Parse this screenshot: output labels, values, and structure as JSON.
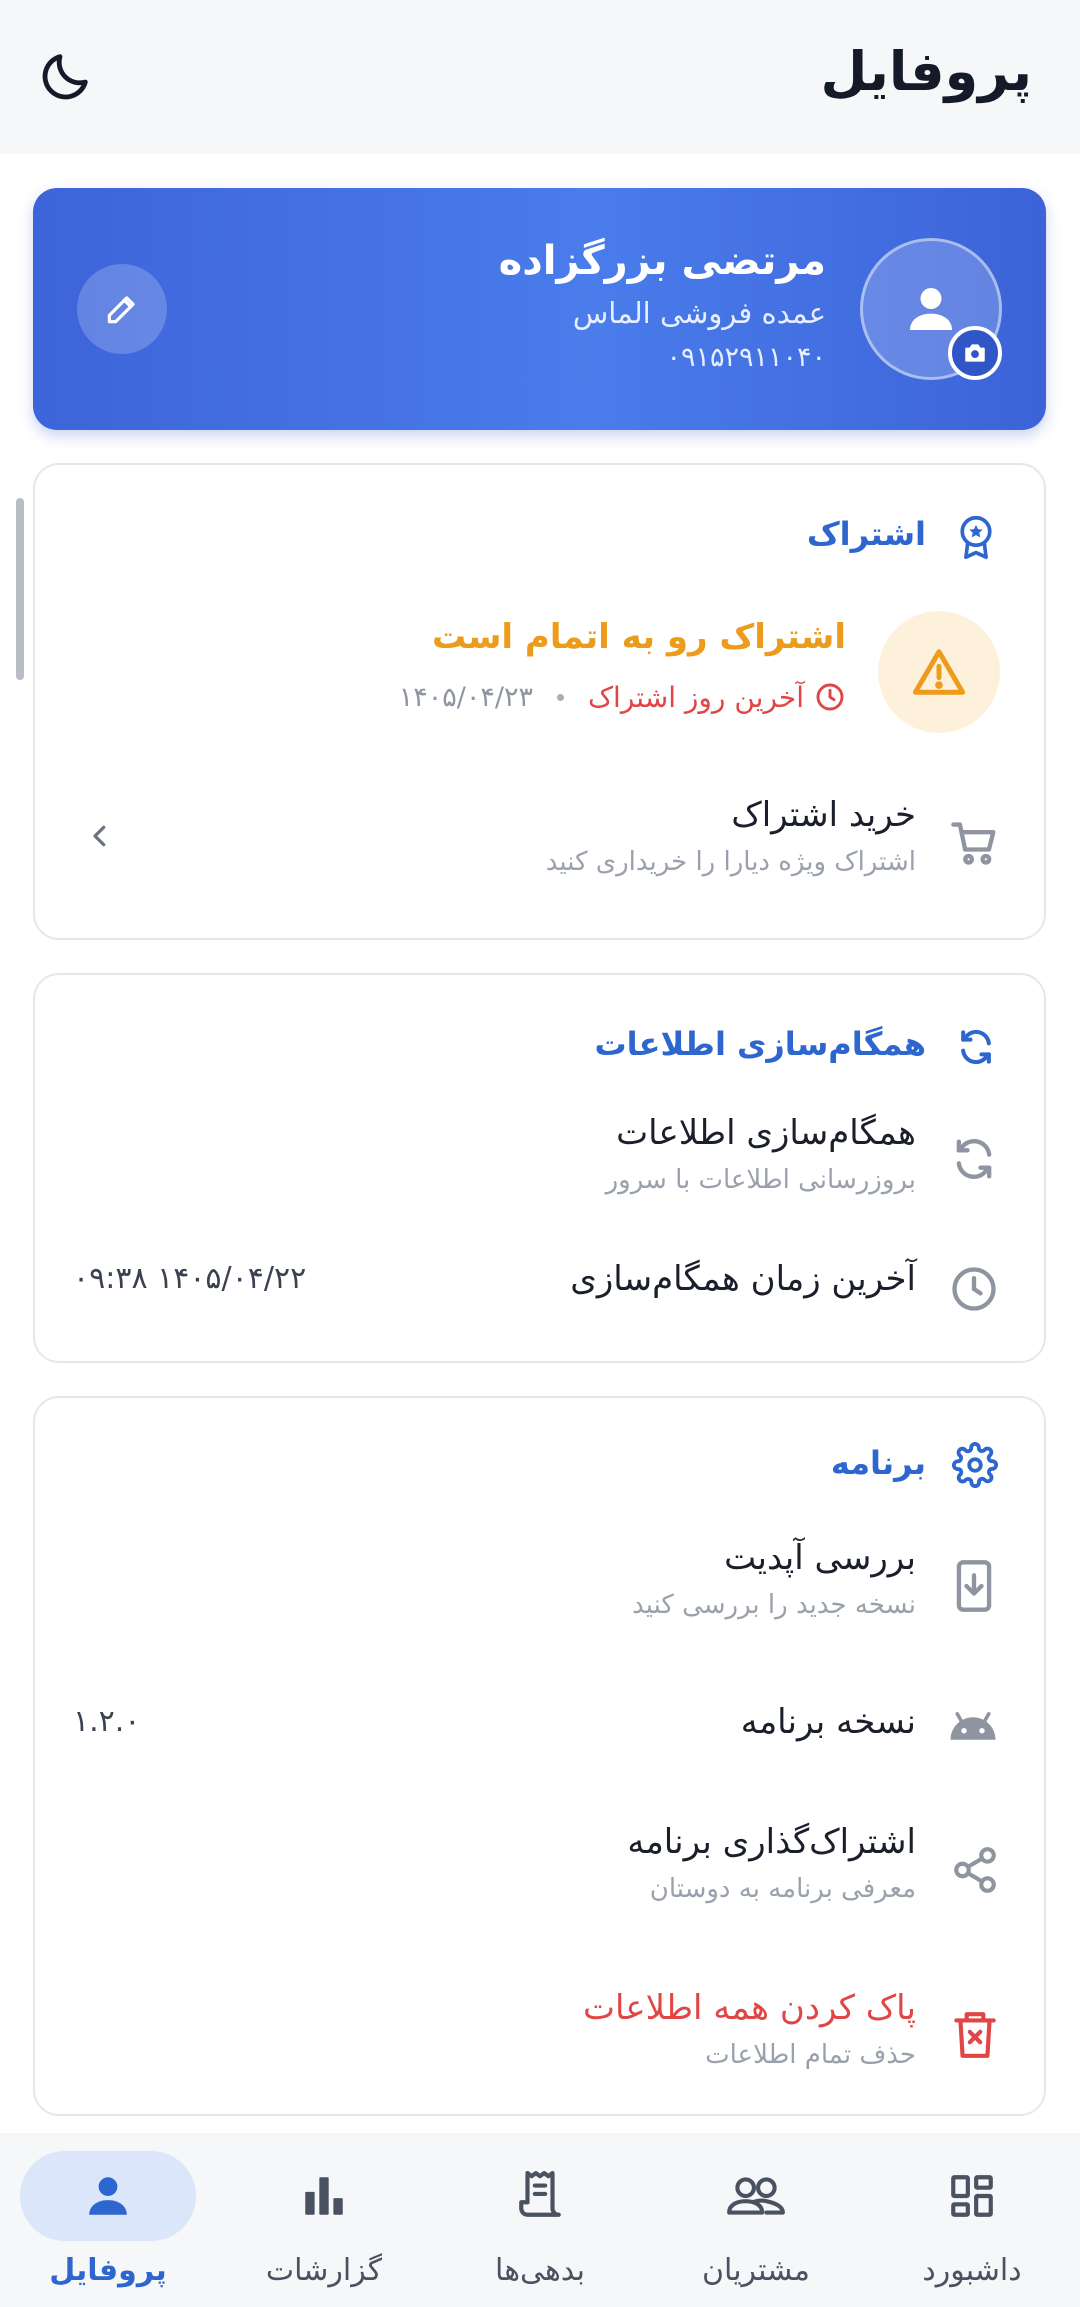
{
  "app_bar": {
    "title": "پروفایل",
    "theme_icon": "moon-icon"
  },
  "profile": {
    "name": "مرتضی بزرگزاده",
    "business": "عمده فروشی الماس",
    "phone": "۰۹۱۵۲۹۱۱۰۴۰",
    "avatar_icon": "person-icon",
    "camera_icon": "camera-icon",
    "edit_icon": "pencil-icon"
  },
  "subscription": {
    "title": "اشتراک",
    "icon": "badge-icon",
    "warning_title": "اشتراک رو به اتمام است",
    "last_day_label": "آخرین روز اشتراک",
    "last_day_date": "۱۴۰۵/۰۴/۲۳",
    "buy_title": "خرید اشتراک",
    "buy_subtitle": "اشتراک ویژه دیارا را خریداری کنید"
  },
  "sync": {
    "title": "همگام‌سازی اطلاعات",
    "row_title": "همگام‌سازی اطلاعات",
    "row_subtitle": "بروزرسانی اطلاعات با سرور",
    "last_sync_label": "آخرین زمان همگام‌سازی",
    "last_sync_value": "۰۹:۳۸ ۱۴۰۵/۰۴/۲۲"
  },
  "app": {
    "title": "برنامه",
    "update_title": "بررسی آپدیت",
    "update_subtitle": "نسخه جدید را بررسی کنید",
    "version_label": "نسخه برنامه",
    "version_value": "۱.۲.۰",
    "share_title": "اشتراک‌گذاری برنامه",
    "share_subtitle": "معرفی برنامه به دوستان",
    "clear_title": "پاک کردن همه اطلاعات",
    "clear_subtitle": "حذف تمام اطلاعات"
  },
  "bottom_nav": {
    "items": [
      {
        "label": "پروفایل",
        "icon": "person-icon",
        "active": true
      },
      {
        "label": "گزارشات",
        "icon": "bar-chart-icon",
        "active": false
      },
      {
        "label": "بدهی‌ها",
        "icon": "receipt-icon",
        "active": false
      },
      {
        "label": "مشتریان",
        "icon": "people-icon",
        "active": false
      },
      {
        "label": "داشبورد",
        "icon": "dashboard-icon",
        "active": false
      }
    ]
  },
  "colors": {
    "accent": "#2e66cf",
    "warning": "#ec9b1a",
    "danger": "#e04646",
    "profile_card": "#4170df"
  }
}
